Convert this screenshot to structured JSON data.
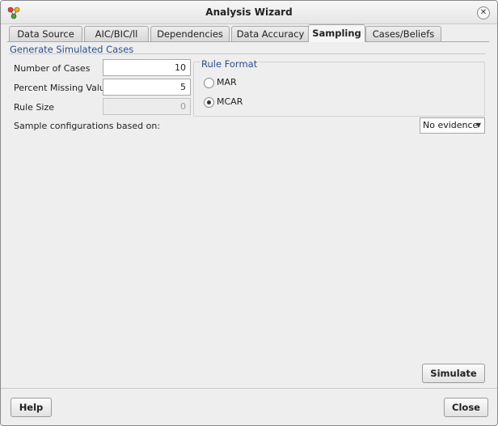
{
  "window": {
    "title": "Analysis Wizard",
    "close_icon": "close-icon",
    "app_icon": "network-nodes-icon"
  },
  "tabs": [
    {
      "label": "Data Source",
      "active": false
    },
    {
      "label": "AIC/BIC/ll",
      "active": false
    },
    {
      "label": "Dependencies",
      "active": false
    },
    {
      "label": "Data Accuracy",
      "active": false
    },
    {
      "label": "Sampling",
      "active": true
    },
    {
      "label": "Cases/Beliefs",
      "active": false
    }
  ],
  "group": {
    "title": "Generate Simulated Cases"
  },
  "fields": {
    "num_cases": {
      "label": "Number of Cases",
      "value": "10"
    },
    "pct_missing": {
      "label": "Percent Missing Values",
      "value": "5"
    },
    "rule_size": {
      "label": "Rule Size",
      "value": "0",
      "disabled": true
    }
  },
  "rule_format": {
    "title": "Rule Format",
    "options": [
      {
        "label": "MAR",
        "selected": false
      },
      {
        "label": "MCAR",
        "selected": true
      }
    ]
  },
  "sample_config": {
    "label": "Sample configurations based on:",
    "selected": "No evidence"
  },
  "buttons": {
    "simulate": "Simulate",
    "help": "Help",
    "close": "Close"
  }
}
